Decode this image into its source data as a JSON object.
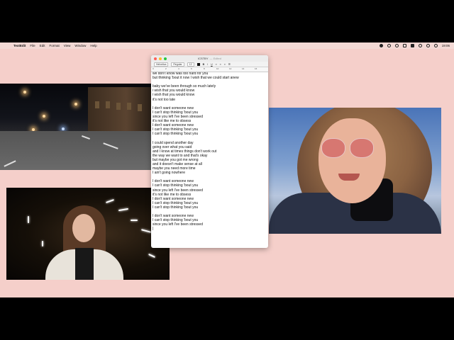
{
  "menubar": {
    "apple_glyph": "",
    "app_name": "TextEdit",
    "menus": [
      "File",
      "Edit",
      "Format",
      "View",
      "Window",
      "Help"
    ],
    "clock": "19:06"
  },
  "window": {
    "title": "ICSTBY",
    "edited_label": "— Edited",
    "toolbar": {
      "font_family": "Helvetica",
      "font_style": "Regular",
      "font_size": "12",
      "bold": "B",
      "italic": "I",
      "underline": "U"
    },
    "ruler_ticks": [
      "0",
      "2",
      "4",
      "6",
      "8",
      "10",
      "12",
      "14",
      "16"
    ]
  },
  "lyrics": [
    "we don't know was too hard for you",
    "but thinking 'bout it now I wish that we could start anew",
    "",
    "baby we've been through so much lately",
    "i wish that you would know",
    "i wish that you would know",
    "it's not too late",
    "",
    "I don't want someone new",
    "I can't stop thinking 'bout you",
    "since you left I've been stressed",
    "it's not like me to obsess",
    "I don't want someone new",
    "I can't stop thinking 'bout you",
    "I can't stop thinking 'bout you",
    "",
    "I could spend another day",
    "going over what you said",
    "and I know at times things don't work out",
    "the way we want to and that's okay",
    "but maybe you got me wrong",
    "and it doesn't make sense at all",
    "maybe you need more time",
    "I ain't going nowhere",
    "",
    "I don't want someone new",
    "I can't stop thinking 'bout you",
    "since you left I've been stressed",
    "it's not like me to obsess",
    "I don't want someone new",
    "I can't stop thinking 'bout you",
    "I can't stop thinking 'bout you",
    "",
    "I don't want someone new",
    "I can't stop thinking 'bout you",
    "since you left I've been stressed",
    "|"
  ],
  "colors": {
    "desktop": "#f5cfca",
    "letterbox": "#000000"
  }
}
